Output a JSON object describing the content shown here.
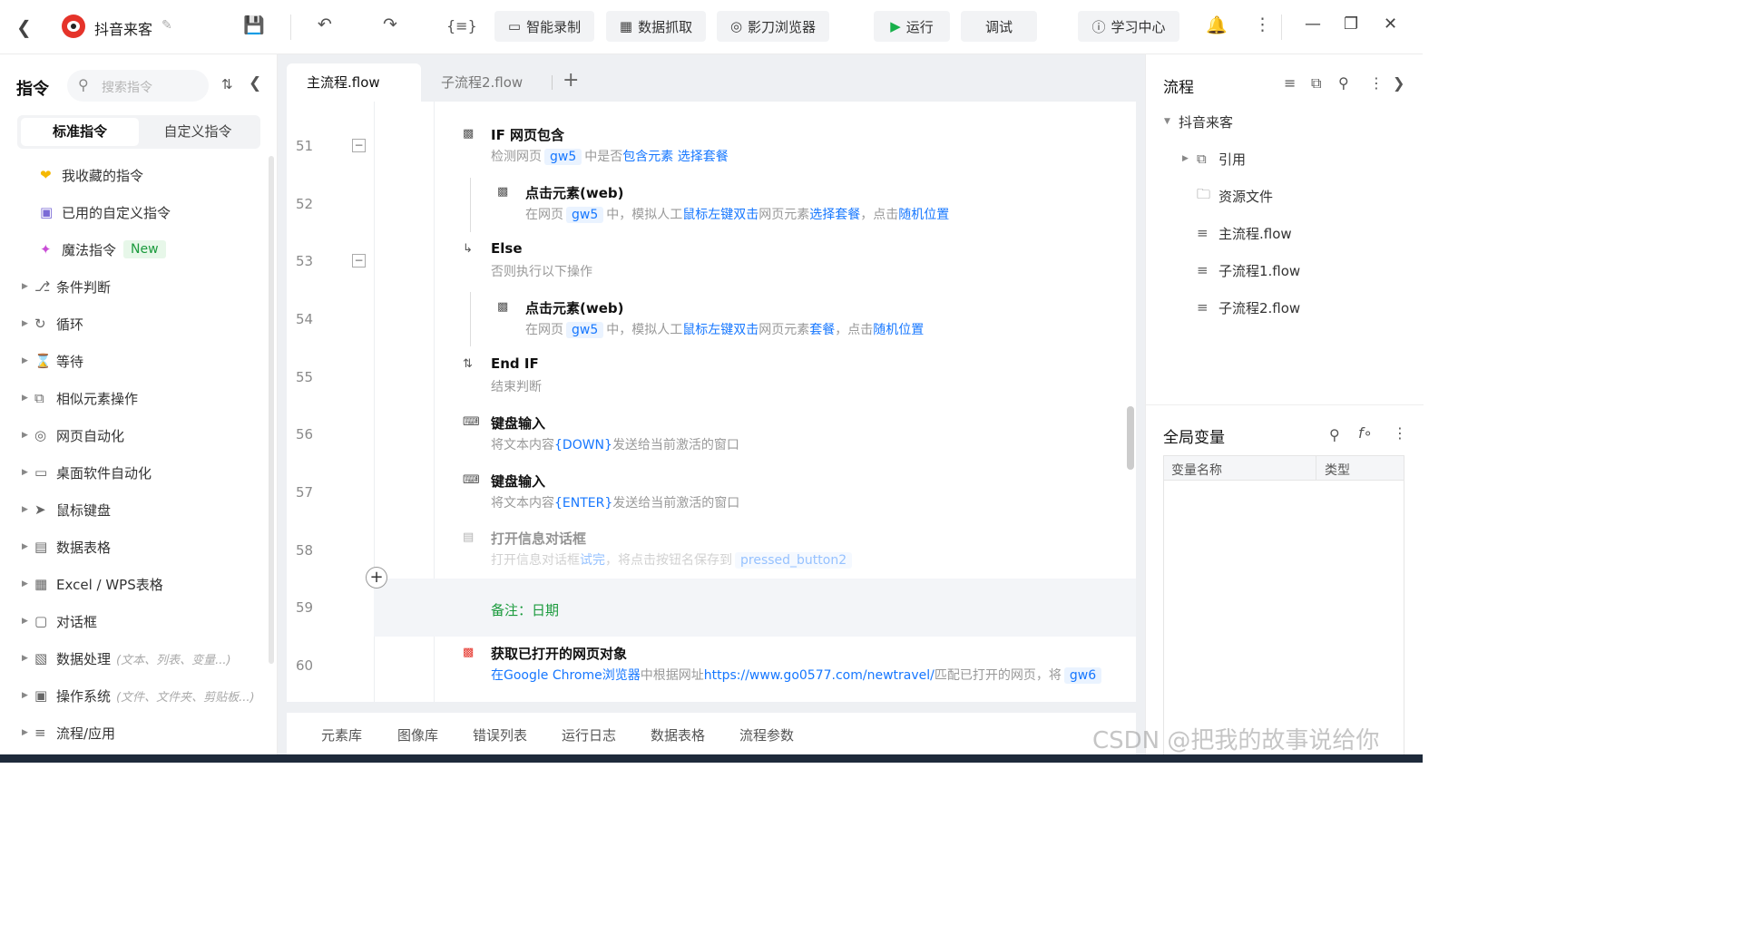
{
  "app": {
    "title": "抖音来客"
  },
  "toolbar": {
    "smart_record": "智能录制",
    "data_scrape": "数据抓取",
    "browser": "影刀浏览器",
    "run": "运行",
    "debug": "调试",
    "learn": "学习中心"
  },
  "sidebar": {
    "title": "指令",
    "search_placeholder": "搜索指令",
    "tab_standard": "标准指令",
    "tab_custom": "自定义指令",
    "items": [
      {
        "label": "我收藏的指令"
      },
      {
        "label": "已用的自定义指令"
      },
      {
        "label": "魔法指令",
        "badge": "New"
      },
      {
        "label": "条件判断"
      },
      {
        "label": "循环"
      },
      {
        "label": "等待"
      },
      {
        "label": "相似元素操作"
      },
      {
        "label": "网页自动化"
      },
      {
        "label": "桌面软件自动化"
      },
      {
        "label": "鼠标键盘"
      },
      {
        "label": "数据表格"
      },
      {
        "label": "Excel / WPS表格"
      },
      {
        "label": "对话框"
      },
      {
        "label": "数据处理",
        "hint": "(文本、列表、变量...)"
      },
      {
        "label": "操作系统",
        "hint": "(文件、文件夹、剪贴板...)"
      },
      {
        "label": "流程/应用"
      }
    ]
  },
  "editor": {
    "tabs": [
      "主流程.flow",
      "子流程2.flow"
    ],
    "lines": [
      "51",
      "52",
      "53",
      "54",
      "55",
      "56",
      "57",
      "58",
      "59",
      "60"
    ],
    "steps": {
      "s51": {
        "title": "IF 网页包含",
        "d1": "检测网页",
        "var": "gw5",
        "d2": "中是否",
        "d3": "包含元素",
        "d4": "选择套餐"
      },
      "s52": {
        "title": "点击元素(web)",
        "d1": "在网页",
        "var": "gw5",
        "d2": "中，模拟人工",
        "d3": "鼠标左键双击",
        "d4": "网页元素",
        "d5": "选择套餐",
        "d6": "，点击",
        "d7": "随机位置"
      },
      "s53": {
        "title": "Else",
        "desc": "否则执行以下操作"
      },
      "s54": {
        "title": "点击元素(web)",
        "d1": "在网页",
        "var": "gw5",
        "d2": "中，模拟人工",
        "d3": "鼠标左键双击",
        "d4": "网页元素",
        "d5": "套餐",
        "d6": "，点击",
        "d7": "随机位置"
      },
      "s55": {
        "title": "End IF",
        "desc": "结束判断"
      },
      "s56": {
        "title": "键盘输入",
        "d1": "将文本内容",
        "d2": "{DOWN}",
        "d3": "发送给当前激活的窗口"
      },
      "s57": {
        "title": "键盘输入",
        "d1": "将文本内容",
        "d2": "{ENTER}",
        "d3": "发送给当前激活的窗口"
      },
      "s58": {
        "title": "打开信息对话框",
        "d1": "打开信息对话框",
        "d2": "试完",
        "d3": "，将点击按钮名保存到",
        "var": "pressed_button2"
      },
      "s59": {
        "comment": "备注：日期"
      },
      "s60": {
        "title": "获取已打开的网页对象",
        "d1": "在",
        "d2": "Google Chrome浏览器",
        "d3": "中根据网址",
        "d4": "https://www.go0577.com/newtravel/",
        "d5": "匹配已打开的网页，将",
        "var": "gw6"
      }
    },
    "bottom_tabs": [
      "元素库",
      "图像库",
      "错误列表",
      "运行日志",
      "数据表格",
      "流程参数"
    ]
  },
  "rpanel": {
    "title": "流程",
    "tree": [
      "抖音来客",
      "引用",
      "资源文件",
      "主流程.flow",
      "子流程1.flow",
      "子流程2.flow"
    ],
    "vars_title": "全局变量",
    "col_name": "变量名称",
    "col_type": "类型"
  },
  "watermark": "CSDN @把我的故事说给你"
}
